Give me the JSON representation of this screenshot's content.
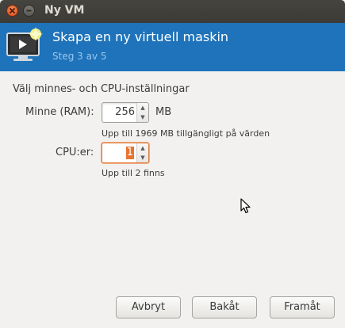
{
  "window": {
    "title": "Ny VM"
  },
  "header": {
    "title": "Skapa en ny virtuell maskin",
    "step": "Steg 3 av 5"
  },
  "form": {
    "section_title": "Välj minnes- och CPU-inställningar",
    "memory_label": "Minne (RAM):",
    "memory_value": "256",
    "memory_unit": "MB",
    "memory_hint": "Upp till 1969 MB tillgängligt på värden",
    "cpu_label": "CPU:er:",
    "cpu_value": "1",
    "cpu_hint": "Upp till 2 finns"
  },
  "buttons": {
    "cancel": "Avbryt",
    "back": "Bakåt",
    "forward": "Framåt"
  },
  "colors": {
    "header_bg": "#1e73ba",
    "accent_focus": "#e07a3e"
  }
}
